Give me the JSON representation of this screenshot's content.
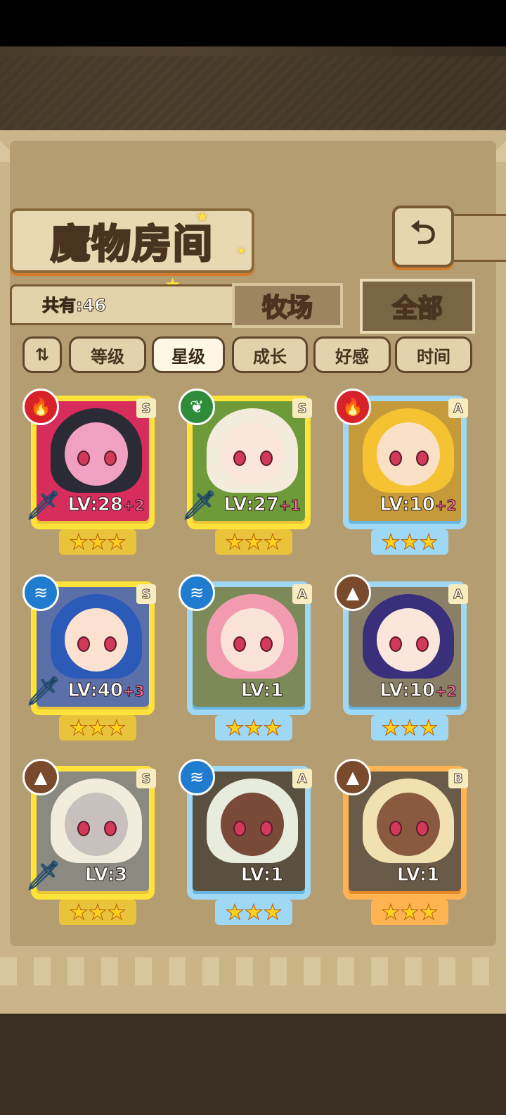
{
  "header": {
    "title": "魔物房间",
    "back_icon": "back-arrow-icon",
    "count_text": "共有:46"
  },
  "tabs": [
    {
      "label": "牧场",
      "active": false
    },
    {
      "label": "全部",
      "active": true
    }
  ],
  "sort": {
    "toggle_icon": "sort-order-icon",
    "buttons": [
      {
        "label": "等级",
        "active": false
      },
      {
        "label": "星级",
        "active": true
      },
      {
        "label": "成长",
        "active": false
      },
      {
        "label": "好感",
        "active": false
      },
      {
        "label": "时间",
        "active": false
      }
    ]
  },
  "monsters": [
    {
      "element": "fire",
      "rank": "S",
      "frame": "gold",
      "level": "LV:28",
      "bonus": "+2",
      "sword": true,
      "stars": 3,
      "hair": "#2b2b35",
      "bg": "#d62d5c",
      "skin": "#f0a0c0"
    },
    {
      "element": "leaf",
      "rank": "S",
      "frame": "gold",
      "level": "LV:27",
      "bonus": "+1",
      "sword": true,
      "stars": 3,
      "hair": "#f3ecdc",
      "bg": "#6f9a3a",
      "skin": "#fbe6dc"
    },
    {
      "element": "fire",
      "rank": "A",
      "frame": "blue",
      "level": "LV:10",
      "bonus": "+2",
      "sword": false,
      "stars": 3,
      "hair": "#f5c232",
      "bg": "#c59a3a",
      "skin": "#fbe0c8"
    },
    {
      "element": "water",
      "rank": "S",
      "frame": "gold",
      "level": "LV:40",
      "bonus": "+3",
      "sword": true,
      "stars": 3,
      "hair": "#2c5ab8",
      "bg": "#5b6fa8",
      "skin": "#fbe2d0"
    },
    {
      "element": "water",
      "rank": "A",
      "frame": "blue",
      "level": "LV:1",
      "bonus": "",
      "sword": false,
      "stars": 3,
      "hair": "#f29bb0",
      "bg": "#7c8a5a",
      "skin": "#fbe2d8"
    },
    {
      "element": "earth",
      "rank": "A",
      "frame": "blue",
      "level": "LV:10",
      "bonus": "+2",
      "sword": false,
      "stars": 3,
      "hair": "#3a2f7a",
      "bg": "#8a8068",
      "skin": "#fbe6dc"
    },
    {
      "element": "earth",
      "rank": "S",
      "frame": "gold",
      "level": "LV:3",
      "bonus": "",
      "sword": true,
      "stars": 3,
      "hair": "#f2ecdc",
      "bg": "#8a8a80",
      "skin": "#c8c0bc"
    },
    {
      "element": "water",
      "rank": "A",
      "frame": "blue",
      "level": "LV:1",
      "bonus": "",
      "sword": false,
      "stars": 3,
      "hair": "#e8ecdc",
      "bg": "#5a5040",
      "skin": "#7a4a38"
    },
    {
      "element": "earth",
      "rank": "B",
      "frame": "orange",
      "level": "LV:1",
      "bonus": "",
      "sword": false,
      "stars": 3,
      "hair": "#f1e0b0",
      "bg": "#6a5a48",
      "skin": "#8a5a40"
    }
  ]
}
